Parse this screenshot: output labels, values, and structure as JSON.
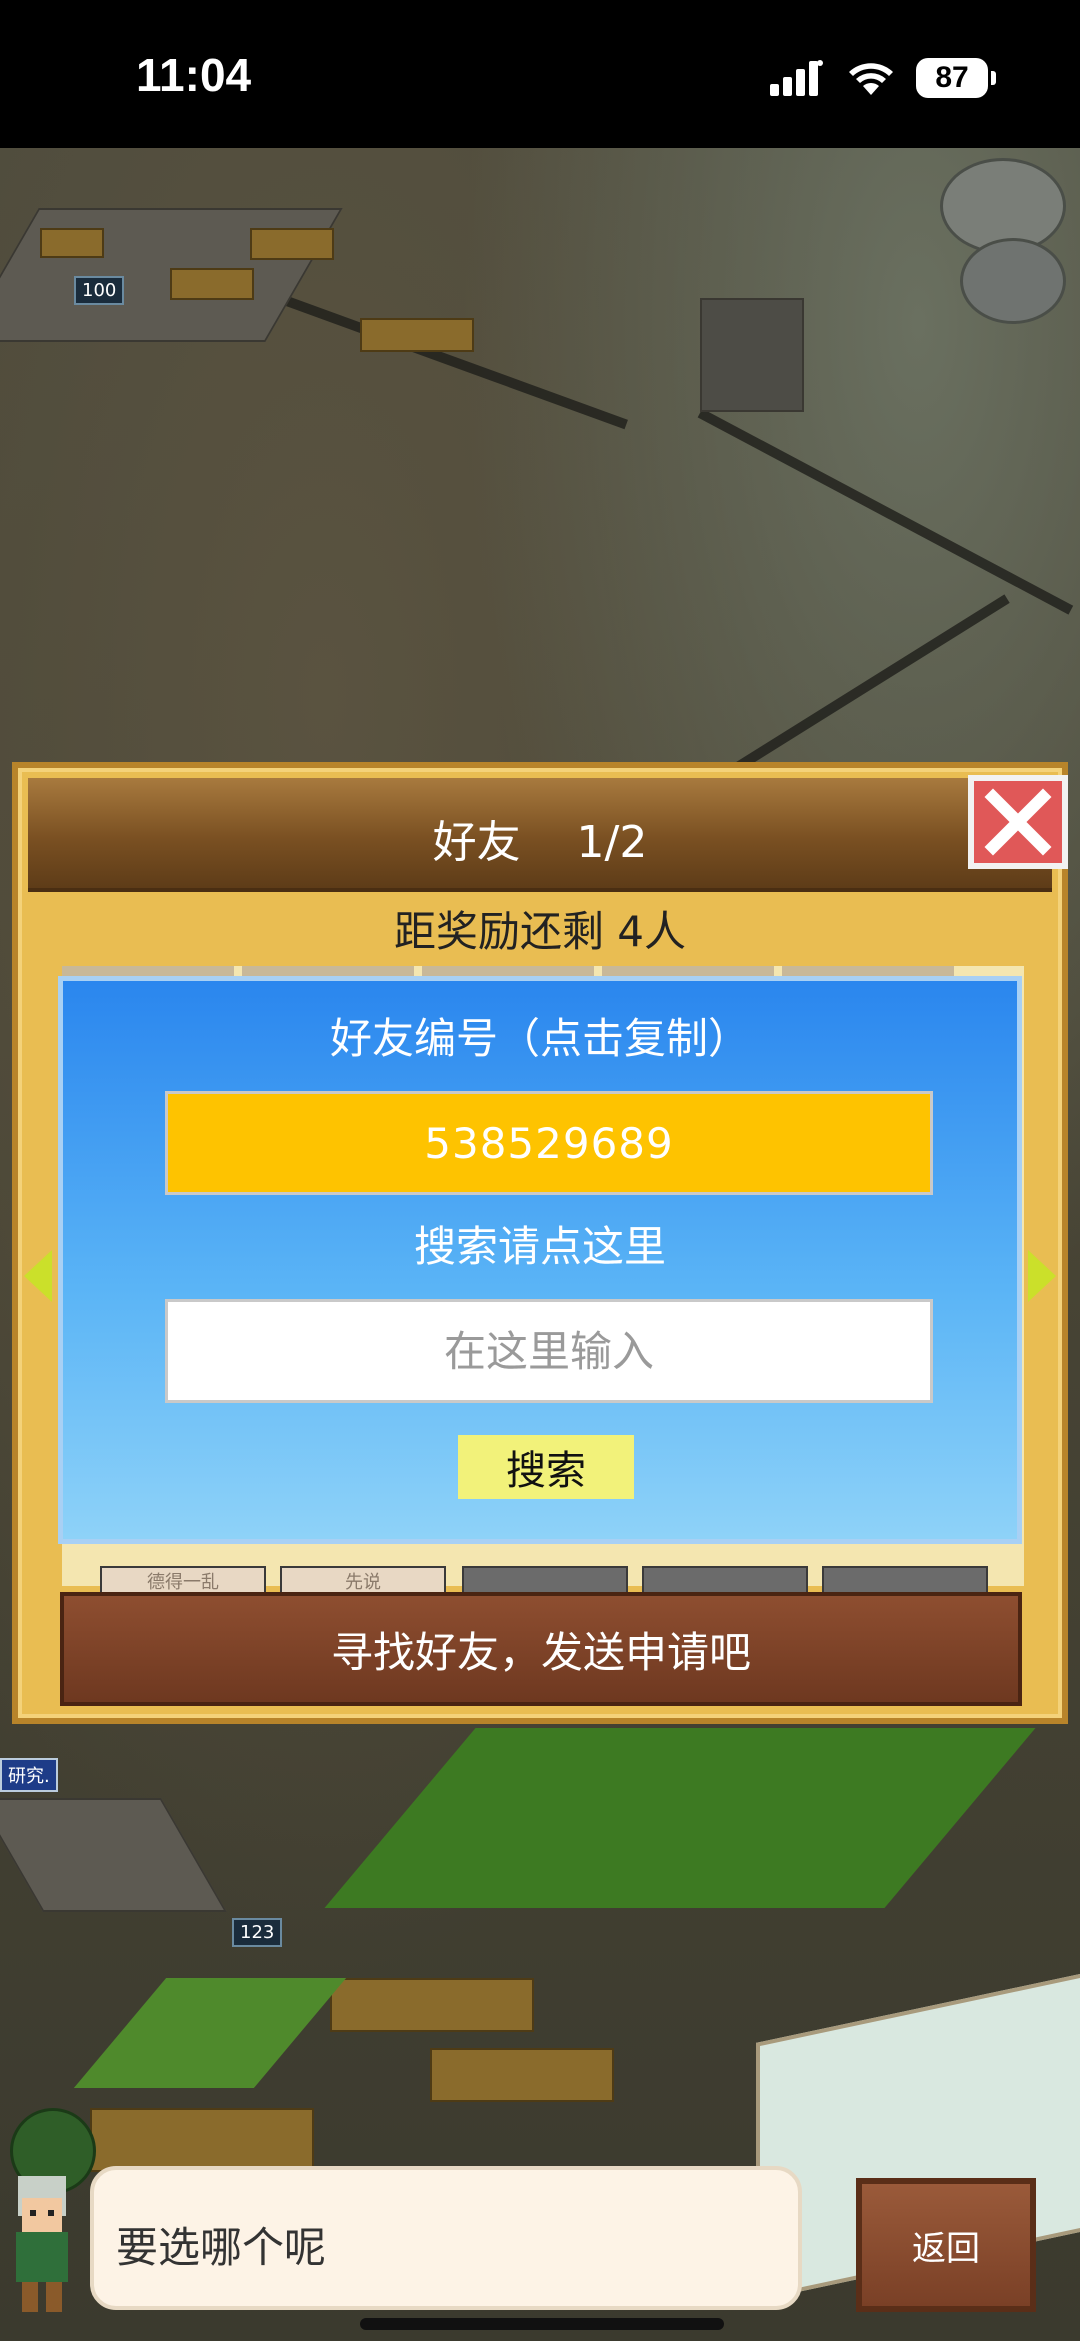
{
  "status_bar": {
    "time": "11:04",
    "battery": "87",
    "icons": [
      "signal-icon",
      "wifi-icon",
      "battery-icon"
    ]
  },
  "map": {
    "tags": [
      "100",
      "123"
    ],
    "sign_text": "研究."
  },
  "dialog": {
    "title": "好友    1/2",
    "reward_text": "距奖励还剩 4人",
    "slot_labels": [
      "德得一乱",
      "先说"
    ],
    "panel": {
      "id_label": "好友编号（点击复制）",
      "friend_id": "538529689",
      "search_label": "搜索请点这里",
      "search_placeholder": "在这里输入",
      "search_value": "",
      "search_button": "搜索"
    },
    "find_friends_button": "寻找好友，发送申请吧"
  },
  "chat": {
    "message": "要选哪个呢",
    "back_button": "返回"
  },
  "colors": {
    "friend_id_bg": "#fec300",
    "close_button": "#e05858",
    "panel_top": "#2a86ee",
    "search_button_bg": "#f2f27a"
  }
}
